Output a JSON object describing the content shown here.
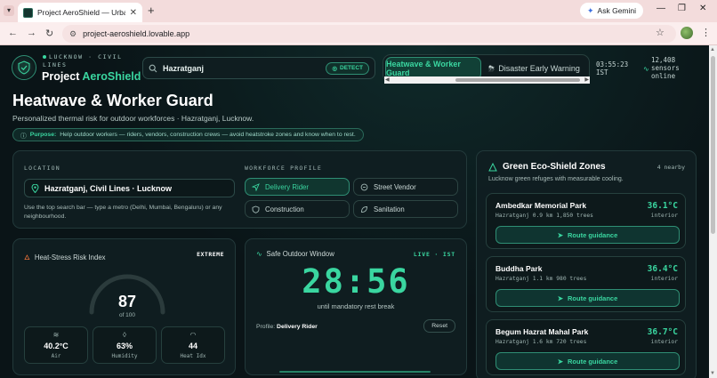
{
  "browser": {
    "tab_title": "Project AeroShield — Urban Cli",
    "new_tab": "+",
    "gemini_label": "Ask Gemini",
    "url": "project-aeroshield.lovable.app"
  },
  "header": {
    "brand_sub_line1": "LUCKNOW · CIVIL",
    "brand_sub_line2": "LINES",
    "brand_name_1": "Project ",
    "brand_name_2": "AeroShield",
    "search_value": "Hazratganj",
    "detect_label": "DETECT",
    "mode_tabs": [
      "Heatwave & Worker Guard",
      "Disaster Early Warning"
    ],
    "clock_time": "03:55:23",
    "clock_zone": "IST",
    "sensors_count": "12,408",
    "sensors_label_1": "sensors",
    "sensors_label_2": "online"
  },
  "page": {
    "title": "Heatwave & Worker Guard",
    "subtitle": "Personalized thermal risk for outdoor workforces · Hazratganj, Lucknow.",
    "purpose_label": "Purpose:",
    "purpose_text": "Help outdoor workers — riders, vendors, construction crews — avoid heatstroke zones and know when to rest."
  },
  "location": {
    "label": "LOCATION",
    "value": "Hazratganj, Civil Lines · Lucknow",
    "help": "Use the top search bar — type a metro (Delhi, Mumbai, Bengaluru) or any neighbourhood."
  },
  "workforce": {
    "label": "WORKFORCE PROFILE",
    "roles": [
      "Delivery Rider",
      "Street Vendor",
      "Construction",
      "Sanitation"
    ],
    "active_role": "Delivery Rider"
  },
  "heat_index": {
    "title": "Heat-Stress Risk Index",
    "level": "EXTREME",
    "value": "87",
    "of_label": "of 100",
    "score": 87,
    "max": 100,
    "metrics": [
      {
        "value": "40.2°C",
        "label": "Air"
      },
      {
        "value": "63%",
        "label": "Humidity"
      },
      {
        "value": "44",
        "label": "Heat Idx"
      }
    ]
  },
  "timer": {
    "title": "Safe Outdoor Window",
    "live_label": "LIVE · IST",
    "value": "28:56",
    "sub": "until mandatory rest break",
    "profile_label": "Profile:",
    "profile_value": "Delivery Rider",
    "reset_label": "Reset"
  },
  "eco": {
    "title": "Green Eco-Shield Zones",
    "count": "4 nearby",
    "subtitle": "Lucknow green refuges with measurable cooling.",
    "route_label": "Route guidance",
    "temp_label": "interior",
    "parks": [
      {
        "name": "Ambedkar Memorial Park",
        "meta": "Hazratganj  0.9 km  1,850 trees",
        "temp": "36.1°C"
      },
      {
        "name": "Buddha Park",
        "meta": "Hazratganj  1.1 km  980 trees",
        "temp": "36.4°C"
      },
      {
        "name": "Begum Hazrat Mahal Park",
        "meta": "Hazratganj  1.6 km  720 trees",
        "temp": "36.7°C"
      }
    ]
  },
  "colors": {
    "accent": "#3ad6a0",
    "background": "#0b1418",
    "card": "#101e21"
  }
}
